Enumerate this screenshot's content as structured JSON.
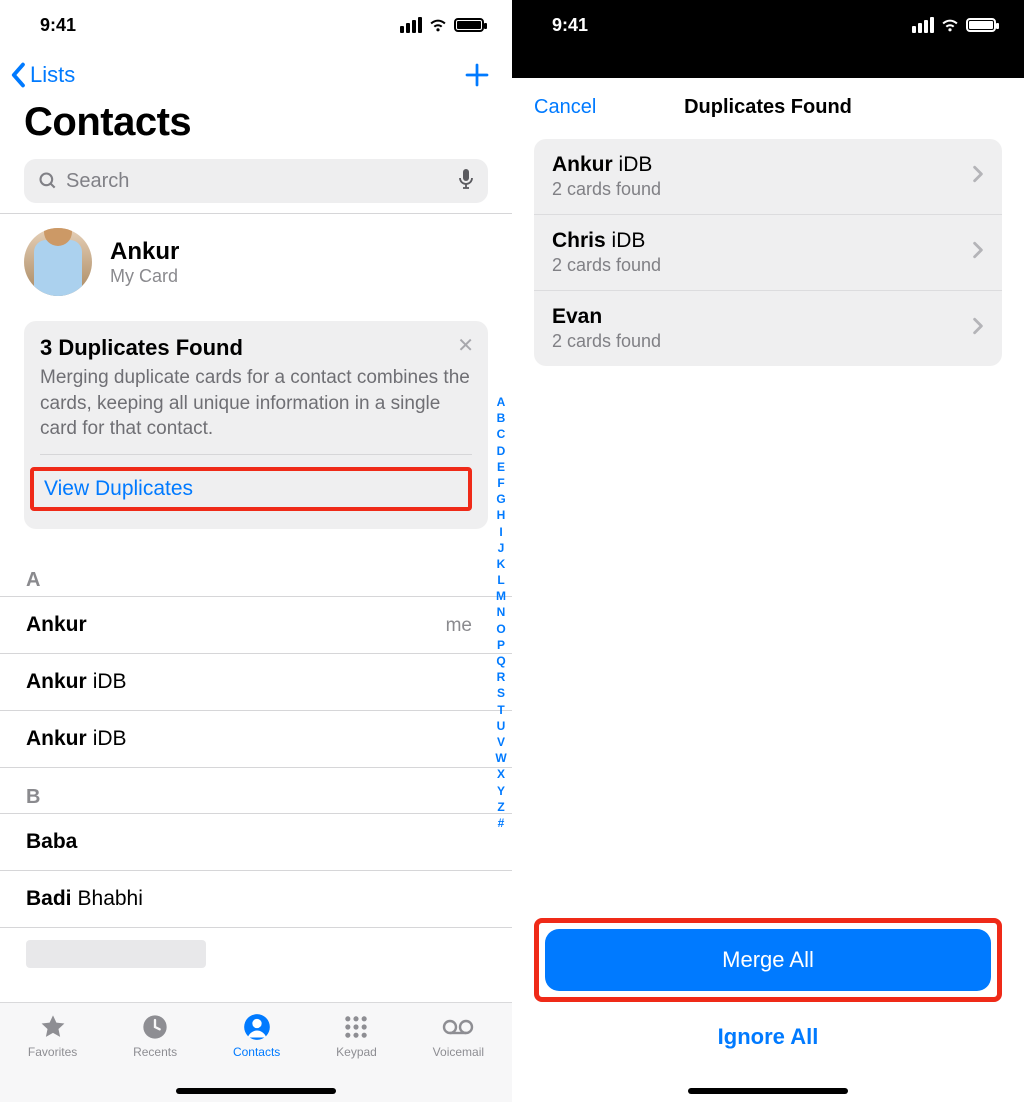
{
  "status": {
    "time": "9:41"
  },
  "left": {
    "nav": {
      "back_label": "Lists"
    },
    "title": "Contacts",
    "search": {
      "placeholder": "Search"
    },
    "mycard": {
      "name": "Ankur",
      "sub": "My Card"
    },
    "dup_banner": {
      "title": "3 Duplicates Found",
      "desc": "Merging duplicate cards for a contact combines the cards, keeping all unique information in a single card for that contact.",
      "action": "View Duplicates"
    },
    "index_letters": [
      "A",
      "B",
      "C",
      "D",
      "E",
      "F",
      "G",
      "H",
      "I",
      "J",
      "K",
      "L",
      "M",
      "N",
      "O",
      "P",
      "Q",
      "R",
      "S",
      "T",
      "U",
      "V",
      "W",
      "X",
      "Y",
      "Z",
      "#"
    ],
    "sections": [
      {
        "letter": "A",
        "rows": [
          {
            "bold": "Ankur",
            "light": "",
            "me": "me"
          },
          {
            "bold": "Ankur",
            "light": " iDB"
          },
          {
            "bold": "Ankur",
            "light": " iDB"
          }
        ]
      },
      {
        "letter": "B",
        "rows": [
          {
            "bold": "Baba",
            "light": ""
          },
          {
            "bold": "Badi",
            "light": " Bhabhi"
          }
        ]
      }
    ],
    "tabs": {
      "favorites": "Favorites",
      "recents": "Recents",
      "contacts": "Contacts",
      "keypad": "Keypad",
      "voicemail": "Voicemail"
    }
  },
  "right": {
    "nav": {
      "cancel": "Cancel",
      "title": "Duplicates Found"
    },
    "items": [
      {
        "bold": "Ankur",
        "light": " iDB",
        "sub": "2 cards found"
      },
      {
        "bold": "Chris",
        "light": " iDB",
        "sub": "2 cards found"
      },
      {
        "bold": "Evan",
        "light": "",
        "sub": "2 cards found"
      }
    ],
    "merge_label": "Merge All",
    "ignore_label": "Ignore All"
  }
}
